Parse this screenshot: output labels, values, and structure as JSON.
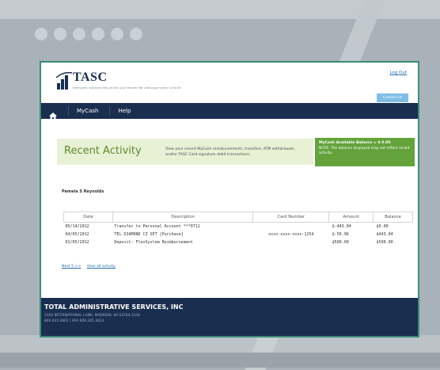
{
  "header": {
    "logo_text": "TASC",
    "tagline": "Innovative solutions that protect your bottom line and assure peace of mind",
    "logout_label": "Log Out",
    "contact_label": "Contact Us"
  },
  "nav": {
    "home_icon": "home-icon",
    "items": [
      {
        "label": "MyCash"
      },
      {
        "label": "Help"
      }
    ]
  },
  "page": {
    "title": "Recent Activity",
    "description": "View your recent MyCash reimbursements, transfers, ATM withdrawals, and/or TASC Card signature debit transactions."
  },
  "balance": {
    "title": "MyCash Available Balance = $ 0.00",
    "note": "NOTE: The balance displayed may not reflect recent activity."
  },
  "member_name": "Pamela S Reynolds",
  "table": {
    "headers": [
      "Date",
      "Description",
      "Card Number",
      "Amount",
      "Balance"
    ],
    "rows": [
      {
        "date": "05/14/2012",
        "description": "Transfer to Personal Account ***0711",
        "card": "",
        "amount": "$-443.04",
        "balance": "$0.00"
      },
      {
        "date": "04/05/2012",
        "description": "TEL DIAMOND CZ SET [Purchase]",
        "card": "xxxx-xxxx-xxxx-1254",
        "amount": "$-56.96",
        "balance": "$443.04"
      },
      {
        "date": "01/05/2012",
        "description": "Deposit: FlexSystem Reimbursement",
        "card": "",
        "amount": "$500.00",
        "balance": "$500.00"
      }
    ]
  },
  "links": {
    "prev_label": "Next 5 >>",
    "all_label": "View all activity"
  },
  "footer": {
    "company": "TOTAL ADMINISTRATIVE SERVICES, INC",
    "address": "2302 INTERNATIONAL LANE, MADISON, WI 53704-3140",
    "phone": "800.422.4661 | FAX 608.245.3623"
  },
  "colors": {
    "navy": "#1a2e4f",
    "green": "#64a33c",
    "accent_frame": "#3a8c7a"
  }
}
